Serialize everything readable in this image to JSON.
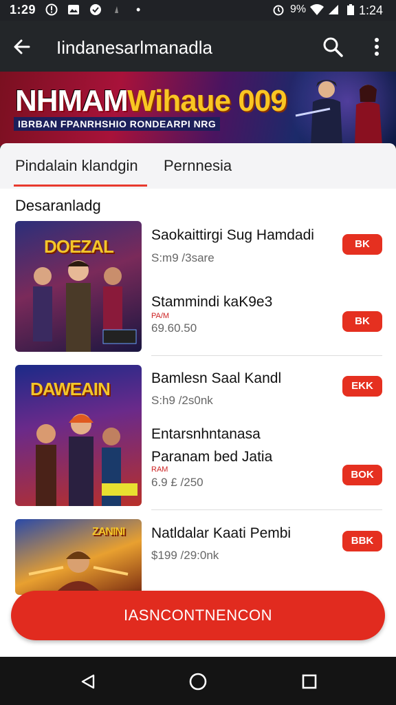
{
  "status_bar": {
    "time": "1:29",
    "battery_text": "9%",
    "right_time": "1:24"
  },
  "app_bar": {
    "title": "Iindanesarlmanadla",
    "back_icon": "back-arrow-icon",
    "search_icon": "search-icon",
    "menu_icon": "more-vert-icon"
  },
  "banner": {
    "headline_white": "NHMAM",
    "headline_yellow": "Wihaue 009",
    "subline": "IBRBAN FPANRHSHIO RONDEARPI NRG"
  },
  "tabs": [
    {
      "label": "Pindalain klandgin",
      "active": true
    },
    {
      "label": "Pernnesia",
      "active": false
    }
  ],
  "section_title": "Desaranladg",
  "items": [
    {
      "thumb_text": "DOEZAL",
      "title": "Saokaittirgi Sug Hamdadi",
      "sub": "S:m9 /3sare",
      "button": "BK"
    },
    {
      "title": "Stammindi kaK9e3",
      "tiny": "PA/M",
      "sub": "69.60.50",
      "button": "BK"
    },
    {
      "thumb_text": "DAWEAIN",
      "title": "Bamlesn Saal Kandl",
      "sub": "S:h9 /2s0nk",
      "button": "EKK"
    },
    {
      "title": "Entarsnhntanasa",
      "title2": "Paranam bed Jatia",
      "tiny": "RAM",
      "sub": "6.9 £ /250",
      "button": "BOK"
    },
    {
      "thumb_text": "ZANINI",
      "title": "Natldalar Kaati Pembi",
      "sub": "$199 /29:0nk",
      "button": "BBK"
    }
  ],
  "cta_label": "IASNCONTNENCON",
  "colors": {
    "accent": "#e53020",
    "appbar": "#232629",
    "tab_underline": "#e8392e"
  }
}
